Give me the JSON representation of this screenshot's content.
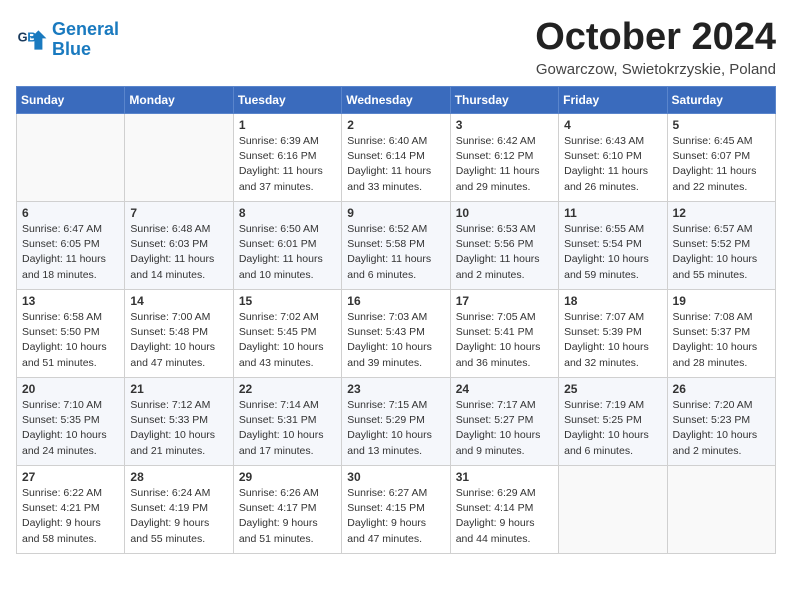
{
  "logo": {
    "line1": "General",
    "line2": "Blue"
  },
  "title": "October 2024",
  "subtitle": "Gowarczow, Swietokrzyskie, Poland",
  "weekdays": [
    "Sunday",
    "Monday",
    "Tuesday",
    "Wednesday",
    "Thursday",
    "Friday",
    "Saturday"
  ],
  "weeks": [
    [
      {
        "day": "",
        "info": ""
      },
      {
        "day": "",
        "info": ""
      },
      {
        "day": "1",
        "info": "Sunrise: 6:39 AM\nSunset: 6:16 PM\nDaylight: 11 hours and 37 minutes."
      },
      {
        "day": "2",
        "info": "Sunrise: 6:40 AM\nSunset: 6:14 PM\nDaylight: 11 hours and 33 minutes."
      },
      {
        "day": "3",
        "info": "Sunrise: 6:42 AM\nSunset: 6:12 PM\nDaylight: 11 hours and 29 minutes."
      },
      {
        "day": "4",
        "info": "Sunrise: 6:43 AM\nSunset: 6:10 PM\nDaylight: 11 hours and 26 minutes."
      },
      {
        "day": "5",
        "info": "Sunrise: 6:45 AM\nSunset: 6:07 PM\nDaylight: 11 hours and 22 minutes."
      }
    ],
    [
      {
        "day": "6",
        "info": "Sunrise: 6:47 AM\nSunset: 6:05 PM\nDaylight: 11 hours and 18 minutes."
      },
      {
        "day": "7",
        "info": "Sunrise: 6:48 AM\nSunset: 6:03 PM\nDaylight: 11 hours and 14 minutes."
      },
      {
        "day": "8",
        "info": "Sunrise: 6:50 AM\nSunset: 6:01 PM\nDaylight: 11 hours and 10 minutes."
      },
      {
        "day": "9",
        "info": "Sunrise: 6:52 AM\nSunset: 5:58 PM\nDaylight: 11 hours and 6 minutes."
      },
      {
        "day": "10",
        "info": "Sunrise: 6:53 AM\nSunset: 5:56 PM\nDaylight: 11 hours and 2 minutes."
      },
      {
        "day": "11",
        "info": "Sunrise: 6:55 AM\nSunset: 5:54 PM\nDaylight: 10 hours and 59 minutes."
      },
      {
        "day": "12",
        "info": "Sunrise: 6:57 AM\nSunset: 5:52 PM\nDaylight: 10 hours and 55 minutes."
      }
    ],
    [
      {
        "day": "13",
        "info": "Sunrise: 6:58 AM\nSunset: 5:50 PM\nDaylight: 10 hours and 51 minutes."
      },
      {
        "day": "14",
        "info": "Sunrise: 7:00 AM\nSunset: 5:48 PM\nDaylight: 10 hours and 47 minutes."
      },
      {
        "day": "15",
        "info": "Sunrise: 7:02 AM\nSunset: 5:45 PM\nDaylight: 10 hours and 43 minutes."
      },
      {
        "day": "16",
        "info": "Sunrise: 7:03 AM\nSunset: 5:43 PM\nDaylight: 10 hours and 39 minutes."
      },
      {
        "day": "17",
        "info": "Sunrise: 7:05 AM\nSunset: 5:41 PM\nDaylight: 10 hours and 36 minutes."
      },
      {
        "day": "18",
        "info": "Sunrise: 7:07 AM\nSunset: 5:39 PM\nDaylight: 10 hours and 32 minutes."
      },
      {
        "day": "19",
        "info": "Sunrise: 7:08 AM\nSunset: 5:37 PM\nDaylight: 10 hours and 28 minutes."
      }
    ],
    [
      {
        "day": "20",
        "info": "Sunrise: 7:10 AM\nSunset: 5:35 PM\nDaylight: 10 hours and 24 minutes."
      },
      {
        "day": "21",
        "info": "Sunrise: 7:12 AM\nSunset: 5:33 PM\nDaylight: 10 hours and 21 minutes."
      },
      {
        "day": "22",
        "info": "Sunrise: 7:14 AM\nSunset: 5:31 PM\nDaylight: 10 hours and 17 minutes."
      },
      {
        "day": "23",
        "info": "Sunrise: 7:15 AM\nSunset: 5:29 PM\nDaylight: 10 hours and 13 minutes."
      },
      {
        "day": "24",
        "info": "Sunrise: 7:17 AM\nSunset: 5:27 PM\nDaylight: 10 hours and 9 minutes."
      },
      {
        "day": "25",
        "info": "Sunrise: 7:19 AM\nSunset: 5:25 PM\nDaylight: 10 hours and 6 minutes."
      },
      {
        "day": "26",
        "info": "Sunrise: 7:20 AM\nSunset: 5:23 PM\nDaylight: 10 hours and 2 minutes."
      }
    ],
    [
      {
        "day": "27",
        "info": "Sunrise: 6:22 AM\nSunset: 4:21 PM\nDaylight: 9 hours and 58 minutes."
      },
      {
        "day": "28",
        "info": "Sunrise: 6:24 AM\nSunset: 4:19 PM\nDaylight: 9 hours and 55 minutes."
      },
      {
        "day": "29",
        "info": "Sunrise: 6:26 AM\nSunset: 4:17 PM\nDaylight: 9 hours and 51 minutes."
      },
      {
        "day": "30",
        "info": "Sunrise: 6:27 AM\nSunset: 4:15 PM\nDaylight: 9 hours and 47 minutes."
      },
      {
        "day": "31",
        "info": "Sunrise: 6:29 AM\nSunset: 4:14 PM\nDaylight: 9 hours and 44 minutes."
      },
      {
        "day": "",
        "info": ""
      },
      {
        "day": "",
        "info": ""
      }
    ]
  ]
}
